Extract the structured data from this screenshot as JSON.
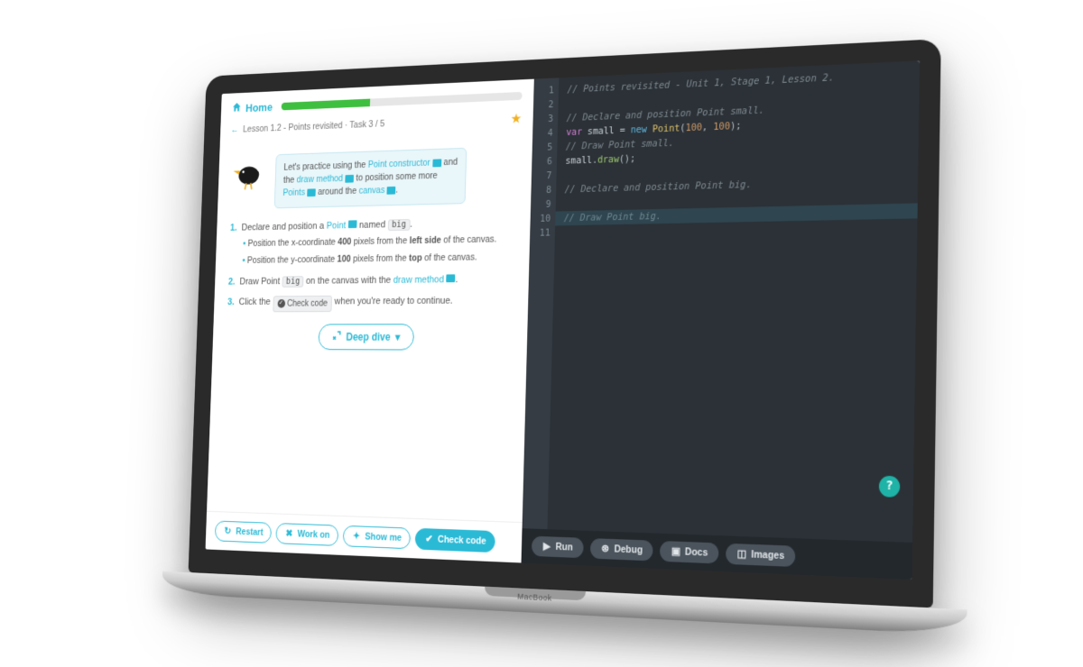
{
  "laptop_label": "MacBook",
  "header": {
    "home_label": "Home",
    "progress_percent": 38,
    "breadcrumb_back": "←",
    "breadcrumb_text": "Lesson 1.2 - Points revisited · Task 3 / 5"
  },
  "intro": {
    "l1a": "Let's practice using the ",
    "l1b": "Point constructor",
    "l1c": " and",
    "l2a": "the ",
    "l2b": "draw method",
    "l2c": " to position some more",
    "l3a": "Points",
    "l3b": " around the ",
    "l3c": "canvas",
    "l3d": "."
  },
  "instructions": {
    "s1_a": "Declare and position a ",
    "s1_kw": "Point",
    "s1_b": " named ",
    "s1_code": "big",
    "s1_c": ".",
    "s1_sub1_a": "Position the x-coordinate ",
    "s1_sub1_b": "400",
    "s1_sub1_c": " pixels from the ",
    "s1_sub1_d": "left side",
    "s1_sub1_e": " of the canvas.",
    "s1_sub2_a": "Position the y-coordinate ",
    "s1_sub2_b": "100",
    "s1_sub2_c": " pixels from the ",
    "s1_sub2_d": "top",
    "s1_sub2_e": " of the canvas.",
    "s2_a": "Draw Point ",
    "s2_code": "big",
    "s2_b": " on the canvas with the ",
    "s2_kw": "draw method",
    "s2_c": ".",
    "s3_a": "Click the ",
    "s3_btn": "Check code",
    "s3_b": " when you're ready to continue."
  },
  "deep_dive_label": "Deep dive",
  "left_buttons": {
    "restart": "Restart",
    "work_on": "Work on",
    "show_me": "Show me",
    "check_code": "Check code"
  },
  "editor_lines": [
    {
      "n": 1,
      "type": "cm",
      "text": "// Points revisited - Unit 1, Stage 1, Lesson 2."
    },
    {
      "n": 2,
      "type": "blank",
      "text": ""
    },
    {
      "n": 3,
      "type": "cm",
      "text": "// Declare and position Point small."
    },
    {
      "n": 4,
      "type": "code",
      "text": "var small = new Point(100, 100);"
    },
    {
      "n": 5,
      "type": "cm",
      "text": "// Draw Point small."
    },
    {
      "n": 6,
      "type": "code2",
      "text": "small.draw();"
    },
    {
      "n": 7,
      "type": "blank",
      "text": ""
    },
    {
      "n": 8,
      "type": "cm",
      "text": "// Declare and position Point big."
    },
    {
      "n": 9,
      "type": "blank",
      "text": ""
    },
    {
      "n": 10,
      "type": "cm",
      "text": "// Draw Point big.",
      "highlight": true
    },
    {
      "n": 11,
      "type": "blank",
      "text": ""
    }
  ],
  "right_buttons": {
    "run": "Run",
    "debug": "Debug",
    "docs": "Docs",
    "images": "Images"
  },
  "help_label": "?"
}
